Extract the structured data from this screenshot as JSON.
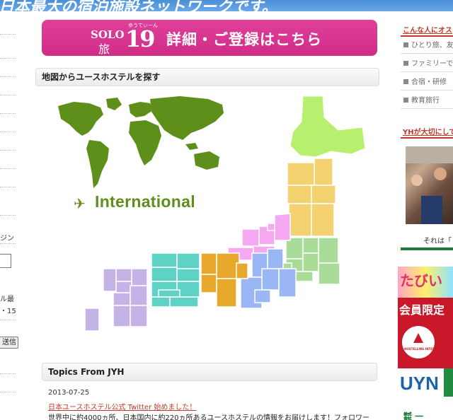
{
  "header": {
    "banner_text": "日本最大の宿泊施設ネットワークです。"
  },
  "left_sidebar": {
    "label_login": "ジン",
    "label_member": "ル最",
    "label_date": "・15",
    "send_button": "送信"
  },
  "main": {
    "solo_banner": {
      "solo": "SOLO",
      "tabi": "旅",
      "small": "ゆうてぃーん",
      "number": "19",
      "text": "詳細・ご登録はこちら"
    },
    "map_section": {
      "title": "地図からユースホステルを探す",
      "international_label": "International"
    },
    "topics": {
      "title": "Topics From JYH",
      "date": "2013-07-25",
      "link": "日本ユースホステル公式 Twitter 始めました！",
      "body": "世界中に約4000ヵ所、日本国内に約220ヵ所あるユースホステルの情報をお届けします！フォロワー"
    }
  },
  "right_sidebar": {
    "head1": "こんな人にオス",
    "items": [
      "ひとり旅、友",
      "ファミリーで",
      "合宿・研修",
      "教育旅行"
    ],
    "head2": "YHが大切にして",
    "caption": "それは「",
    "ad_tabi": "たびい",
    "ad_member": "会員限定",
    "ad_logo_text": "HOSTELLING INTERNATIONAL",
    "ad_uyn": "UYN",
    "ad_bottom": "㍿ 一"
  },
  "colors": {
    "hokkaido": "#b6f06e",
    "tohoku": "#f3d26f",
    "kanto": "#a8dc98",
    "chubu": "#f6a8f2",
    "kinki": "#9ab6f4",
    "chugoku": "#e8a82c",
    "shikoku": "#5fd2c6",
    "kyushu": "#c3b3e6",
    "world": "#5e8f1b",
    "pink_banner": "#e0409a"
  }
}
